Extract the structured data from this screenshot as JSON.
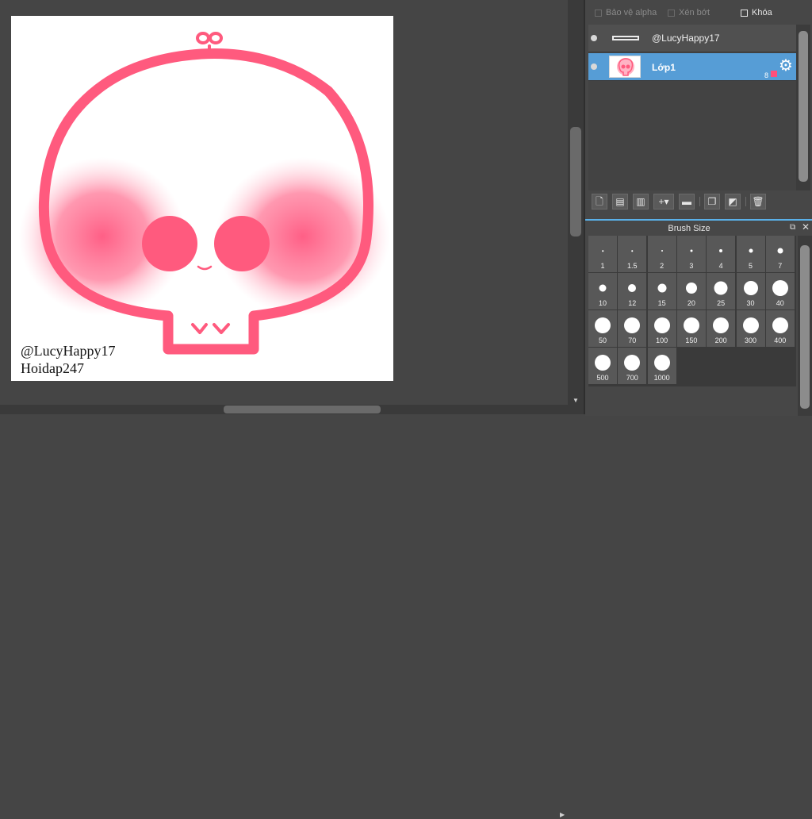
{
  "canvas": {
    "watermark_line1": "@LucyHappy17",
    "watermark_line2": "Hoidap247",
    "artwork": "pink-skull-doodle",
    "colors": {
      "line": "#ff5a7e",
      "blush": "#ff6f92",
      "paper": "#ffffff"
    }
  },
  "layer_options": {
    "protect_alpha": "Bảo vệ alpha",
    "clipping": "Xén bớt",
    "lock": "Khóa"
  },
  "layers": [
    {
      "name": "@LucyHappy17",
      "visible": true,
      "selected": false
    },
    {
      "name": "Lớp1",
      "visible": true,
      "selected": true,
      "opacity_label": "8",
      "color": "#ff4f7b"
    }
  ],
  "layer_toolbar": {
    "icons": [
      "new-layer-icon",
      "new-raster-icon",
      "new-vector-icon",
      "add-layer-menu-icon",
      "new-folder-icon",
      "duplicate-layer-icon",
      "merge-layer-icon",
      "delete-layer-icon"
    ]
  },
  "brush_panel": {
    "title": "Brush Size",
    "sizes": [
      "1",
      "1.5",
      "2",
      "3",
      "4",
      "5",
      "7",
      "10",
      "12",
      "15",
      "20",
      "25",
      "30",
      "40",
      "50",
      "70",
      "100",
      "150",
      "200",
      "300",
      "400",
      "500",
      "700",
      "1000"
    ]
  },
  "accent_color": "#569dd6"
}
